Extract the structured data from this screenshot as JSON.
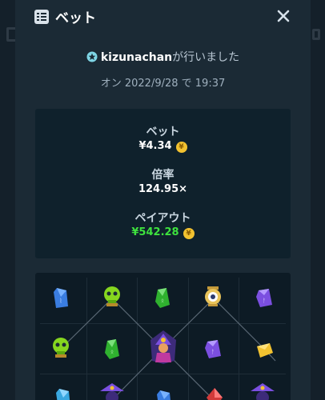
{
  "modal": {
    "title": "ベット",
    "icon": "bet-list-icon",
    "close_icon": "close-icon"
  },
  "player": {
    "username": "kizunachan",
    "action_text": "が行いました",
    "badge_icon": "star-badge-icon"
  },
  "date_text": "オン 2022/9/28 で 19:37",
  "stats": {
    "bet_label": "ベット",
    "bet_value": "¥4.34",
    "multiplier_label": "倍率",
    "multiplier_value": "124.95×",
    "payout_label": "ペイアウト",
    "payout_value": "¥542.28",
    "currency_icon": "yen-coin-icon"
  },
  "colors": {
    "background": "#1b2a35",
    "stats_bg": "#0f212c",
    "payout_green": "#3ee23e",
    "coin_gold": "#f2c230"
  },
  "board": {
    "tiles": [
      "blue-gem-icon",
      "green-skull-icon",
      "green-gem-icon",
      "eye-lantern-icon",
      "purple-gem-icon",
      "green-skull-icon",
      "green-gem-icon",
      "wizard-icon",
      "purple-gem-icon",
      "yellow-gem-icon",
      "blue-gem-icon",
      "wizard-icon",
      "blue-gem-icon",
      "red-gem-icon",
      "wizard-icon"
    ]
  }
}
